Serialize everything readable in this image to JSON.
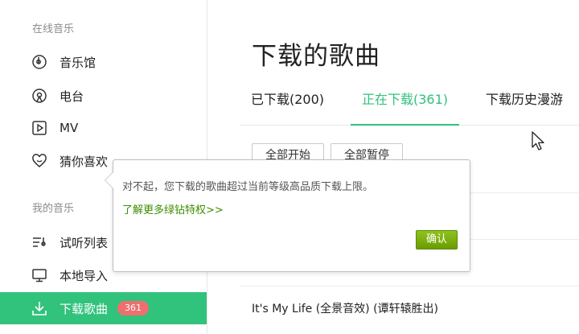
{
  "sidebar": {
    "section_online": "在线音乐",
    "section_mine": "我的音乐",
    "items": [
      {
        "label": "音乐馆",
        "icon": "music-hall-icon"
      },
      {
        "label": "电台",
        "icon": "radio-icon"
      },
      {
        "label": "MV",
        "icon": "mv-play-icon"
      },
      {
        "label": "猜你喜欢",
        "icon": "heart-icon"
      },
      {
        "label": "试听列表",
        "icon": "playlist-icon"
      },
      {
        "label": "本地导入",
        "icon": "monitor-icon"
      },
      {
        "label": "下载歌曲",
        "icon": "download-icon",
        "badge": "361",
        "active": true
      }
    ]
  },
  "main": {
    "title": "下载的歌曲",
    "tabs": [
      {
        "label": "已下载(200)"
      },
      {
        "label": "正在下载(361)",
        "active": true
      },
      {
        "label": "下载历史漫游"
      }
    ],
    "toolbar": {
      "start_all": "全部开始",
      "pause_all": "全部暂停"
    },
    "song_row": "It's My Life (全景音效) (谭轩辕胜出)"
  },
  "popup": {
    "message": "对不起，您下载的歌曲超过当前等级高品质下载上限。",
    "link": "了解更多绿钻特权>>",
    "confirm": "确认"
  },
  "colors": {
    "accent": "#31c27c",
    "badge": "#ef6f6f",
    "link": "#3c8d00",
    "confirm_button": "#7ab000"
  }
}
